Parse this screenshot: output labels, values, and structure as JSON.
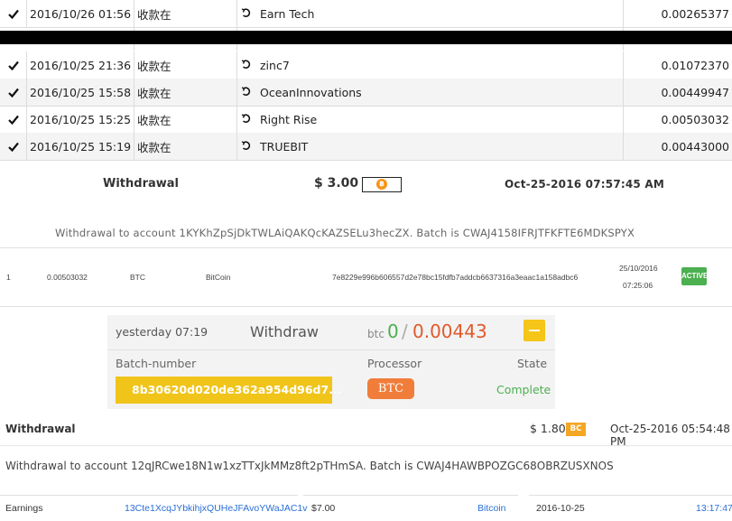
{
  "transactions_top": [
    {
      "date": "2016/10/26 01:56",
      "type": "收款在",
      "name": "Earn Tech",
      "amount": "0.00265377"
    }
  ],
  "transactions": [
    {
      "date": "2016/10/25 21:36",
      "type": "收款在",
      "name": "zinc7",
      "amount": "0.01072370"
    },
    {
      "date": "2016/10/25 15:58",
      "type": "收款在",
      "name": "OceanInnovations",
      "amount": "0.00449947"
    },
    {
      "date": "2016/10/25 15:25",
      "type": "收款在",
      "name": "Right Rise",
      "amount": "0.00503032"
    },
    {
      "date": "2016/10/25 15:19",
      "type": "收款在",
      "name": "TRUEBIT",
      "amount": "0.00443000"
    }
  ],
  "withdrawal_1": {
    "label": "Withdrawal",
    "amount": "$ 3.00",
    "coin_symbol": "฿",
    "date": "Oct-25-2016 07:57:45 AM",
    "info": "Withdrawal to account 1KYKhZpSjDkTWLAiQAKQcKAZSELu3hecZX. Batch is CWAJ4158IFRJTFKFTE6MDKSPYX"
  },
  "tx_row": {
    "index": "1",
    "amount": "0.00503032",
    "currency": "BTC",
    "processor": "BitCoin",
    "hash": "7e8229e996b606557d2e78bc15fdfb7addcb6637316a3eaac1a158adbc6",
    "date": "25/10/2016",
    "time": "07:25:06",
    "status": "ACTIVE"
  },
  "withdraw_card": {
    "time": "yesterday 07:19",
    "title": "Withdraw",
    "unit": "btc",
    "zero": "0",
    "slash": "/",
    "amount": "0.00443",
    "batch_header": "Batch-number",
    "processor_header": "Processor",
    "state_header": "State",
    "batch": "8b30620d020de362a954d96d7...",
    "processor": "BTC",
    "state": "Complete"
  },
  "withdrawal_2": {
    "title": "Withdrawal",
    "amount": "$ 1.80",
    "badge": "BC",
    "date": "Oct-25-2016 05:54:48 PM",
    "info": "Withdrawal to account 12qJRCwe18N1w1xzTTxJkMMz8ft2pTHmSA. Batch is CWAJ4HAWBPOZGC68OBRZUSXNOS"
  },
  "earnings": {
    "label": "Earnings",
    "address": "13Cte1XcqJYbkihjxQUHeJFAvoYWaJAC1v",
    "amount": "$7.00",
    "method": "Bitcoin",
    "date": "2016-10-25",
    "time": "13:17:47"
  },
  "colors": {
    "green": "#4caf50",
    "orange": "#e05a2b",
    "yellow": "#f0c419",
    "btc": "#f7931a",
    "link": "#2a6fd6"
  }
}
